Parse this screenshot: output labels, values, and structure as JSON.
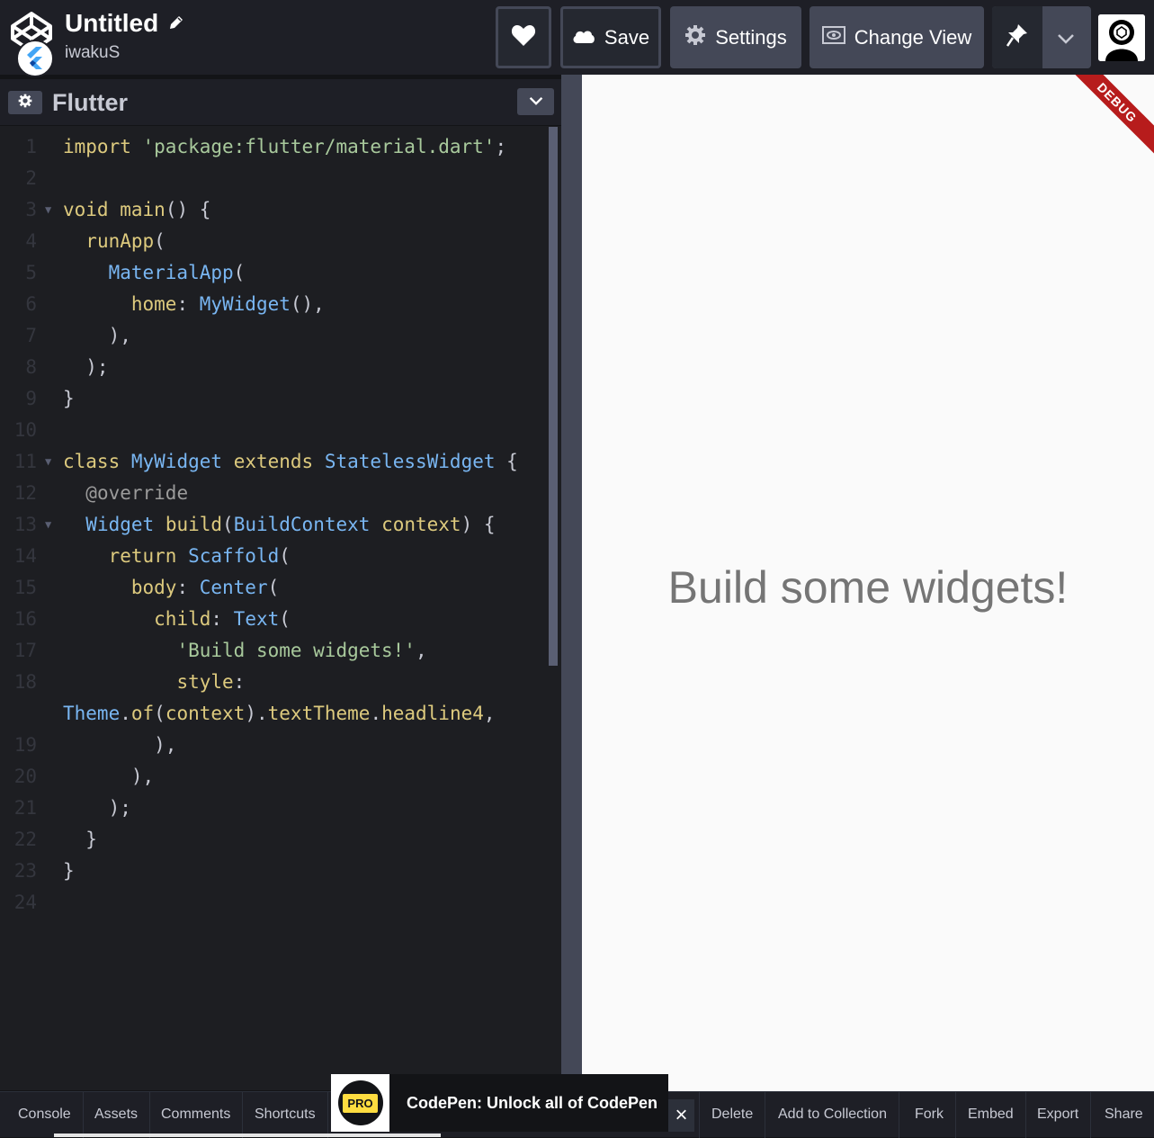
{
  "header": {
    "title": "Untitled",
    "author": "iwakuS",
    "save_label": "Save",
    "settings_label": "Settings",
    "change_view_label": "Change View",
    "icons": {
      "logo": "codepen-logo-icon",
      "badge": "flutter-logo-icon",
      "edit": "pencil-icon",
      "heart": "heart-icon",
      "save": "cloud-icon",
      "settings": "gear-icon",
      "view": "eye-icon",
      "pin": "pin-icon",
      "caret": "chevron-down-icon",
      "avatar": "user-avatar-icon"
    }
  },
  "editor": {
    "title": "Flutter",
    "lines": [
      {
        "n": "1"
      },
      {
        "n": "2"
      },
      {
        "n": "3"
      },
      {
        "n": "4"
      },
      {
        "n": "5"
      },
      {
        "n": "6"
      },
      {
        "n": "7"
      },
      {
        "n": "8"
      },
      {
        "n": "9"
      },
      {
        "n": "10"
      },
      {
        "n": "11"
      },
      {
        "n": "12"
      },
      {
        "n": "13"
      },
      {
        "n": "14"
      },
      {
        "n": "15"
      },
      {
        "n": "16"
      },
      {
        "n": "17"
      },
      {
        "n": "18"
      },
      {
        "n": ""
      },
      {
        "n": "19"
      },
      {
        "n": "20"
      },
      {
        "n": "21"
      },
      {
        "n": "22"
      },
      {
        "n": "23"
      },
      {
        "n": "24"
      }
    ]
  },
  "preview": {
    "text": "Build some widgets!",
    "debug_label": "DEBUG"
  },
  "footer": {
    "console": "Console",
    "assets": "Assets",
    "comments": "Comments",
    "shortcuts": "Shortcuts",
    "pro_badge": "PRO",
    "pro_message": "CodePen: Unlock all of CodePen",
    "close": "×",
    "delete": "Delete",
    "add_to_collection": "Add to Collection",
    "fork": "Fork",
    "embed": "Embed",
    "export": "Export",
    "share": "Share"
  },
  "colors": {
    "header_bg": "#1e1f26",
    "editor_bg": "#1d1e22",
    "button_bg": "#444857",
    "keyword": "#ddca7e",
    "type": "#79b6f2",
    "string": "#a8c99c",
    "preview_text": "#757575",
    "debug_ribbon": "#b71c1c",
    "pro_yellow": "#ffdd40"
  }
}
